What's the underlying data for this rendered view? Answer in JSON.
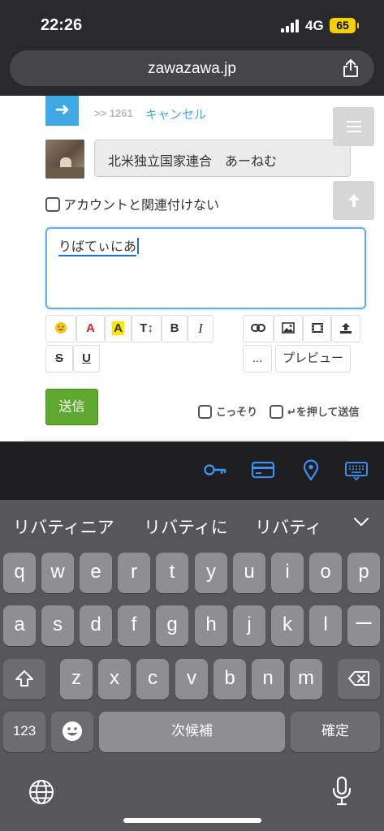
{
  "status": {
    "time": "22:26",
    "network": "4G",
    "battery": "65"
  },
  "browser": {
    "url": "zawazawa.jp"
  },
  "form": {
    "reply_ref": ">> 1261",
    "cancel": "キャンセル",
    "name": "北米独立国家連合　あーねむ",
    "no_account_link": "アカウントと関連付けない",
    "body_text": "りばてぃにあ",
    "toolbar": {
      "strike": "S",
      "underline": "U",
      "text_color": "A",
      "highlight": "A",
      "size": "T↕",
      "bold": "B",
      "italic": "I",
      "more": "...",
      "preview": "プレビュー"
    },
    "send": "送信",
    "stealth": "こっそり",
    "enter_to_send": "↵を押して送信"
  },
  "keyboard": {
    "suggestions": [
      "リバティニア",
      "リバティに",
      "リバティ"
    ],
    "row1": [
      "q",
      "w",
      "e",
      "r",
      "t",
      "y",
      "u",
      "i",
      "o",
      "p"
    ],
    "row2": [
      "a",
      "s",
      "d",
      "f",
      "g",
      "h",
      "j",
      "k",
      "l",
      "ー"
    ],
    "row3": [
      "z",
      "x",
      "c",
      "v",
      "b",
      "n",
      "m"
    ],
    "numbers": "123",
    "space": "次候補",
    "confirm": "確定"
  },
  "colors": {
    "accent_blue": "#3fa9e5",
    "send_green": "#5fa830",
    "battery_yellow": "#f5d000"
  }
}
